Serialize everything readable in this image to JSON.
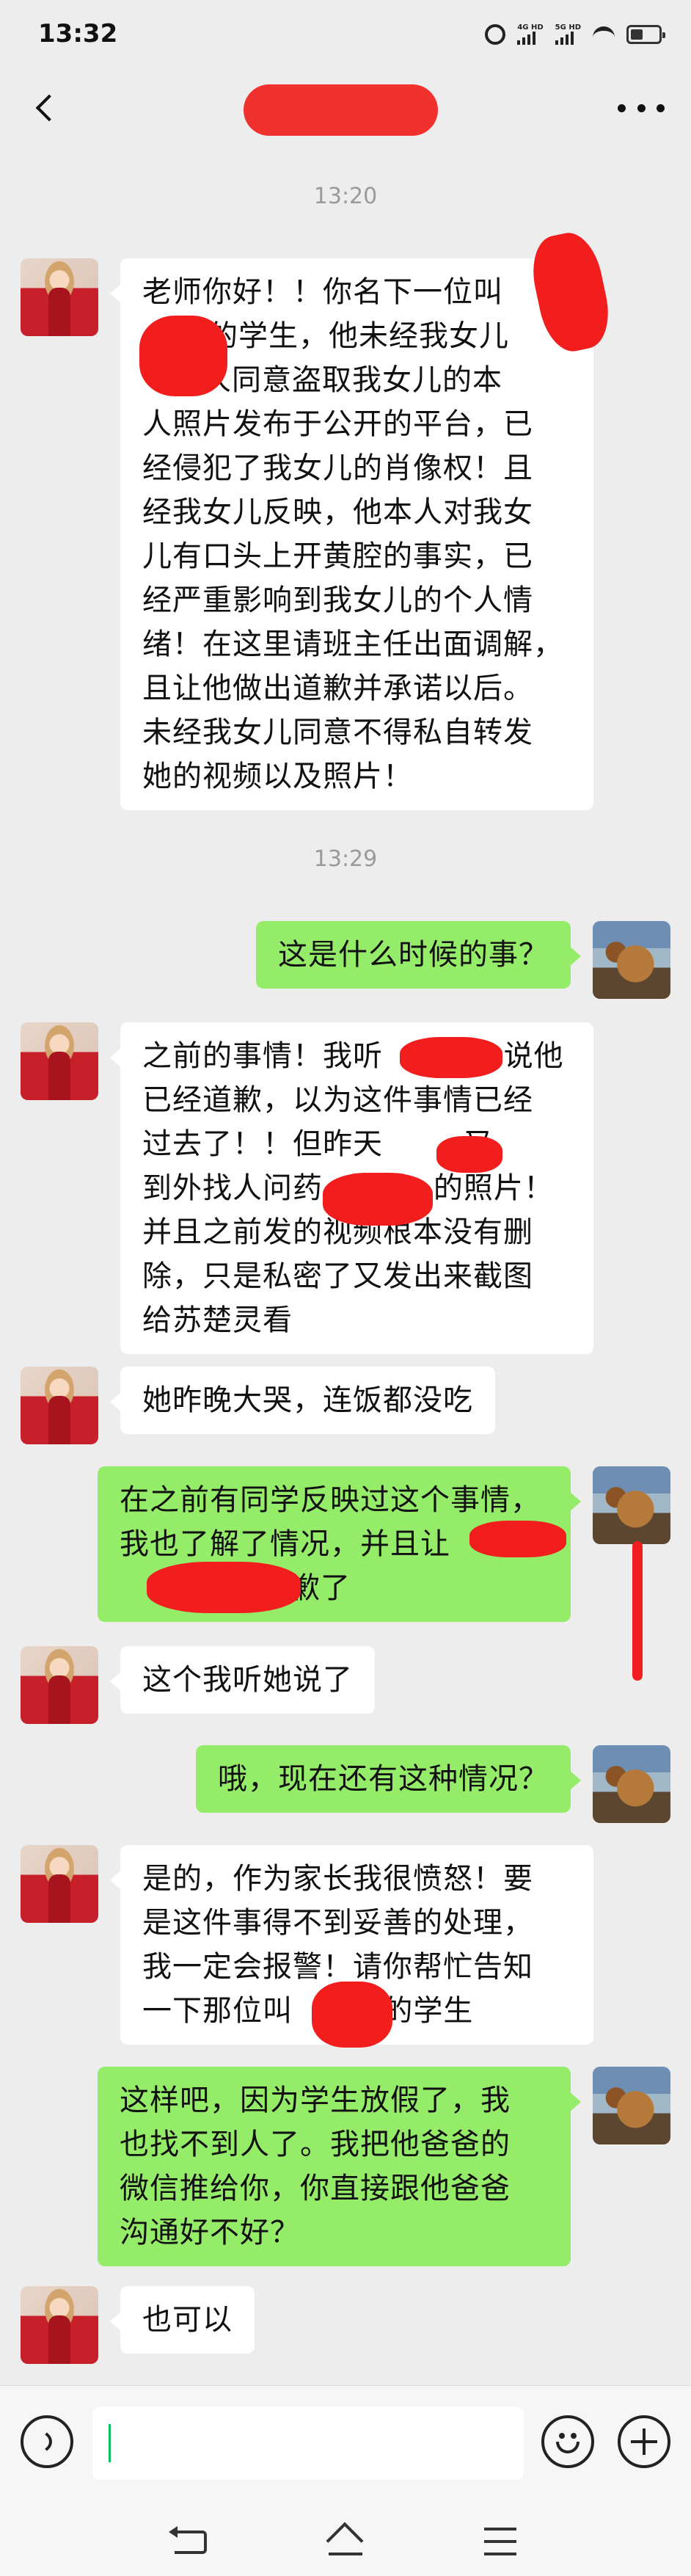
{
  "status_bar": {
    "time": "13:32",
    "signal_1": "4G HD",
    "signal_2": "5G HD"
  },
  "header": {
    "title_redacted": true,
    "redaction_color": "#f0312e"
  },
  "colors": {
    "self_bubble": "#95ec69",
    "other_bubble": "#ffffff",
    "background": "#ededed",
    "redaction": "#f21e1e"
  },
  "timestamps": [
    "13:20",
    "13:29"
  ],
  "messages": [
    {
      "from": "other",
      "lines": [
        "老师你好！！你名下一位叫",
        "的学生，他未经我女儿",
        "本人同意盗取我女儿的本",
        "人照片发布于公开的平台，已",
        "经侵犯了我女儿的肖像权！且",
        "经我女儿反映，他本人对我女",
        "儿有口头上开黄腔的事实，已",
        "经严重影响到我女儿的个人情",
        "绪！在这里请班主任出面调解，",
        "且让他做出道歉并承诺以后。",
        "未经我女儿同意不得私自转发",
        "她的视频以及照片！"
      ]
    },
    {
      "from": "self",
      "lines": [
        "这是什么时候的事？"
      ]
    },
    {
      "from": "other",
      "lines": [
        "之前的事情！我听",
        "已经道歉，以为这件事情已经",
        "过去了！！但昨天",
        "到外找人问药",
        "并且之前发的视频根本没有删",
        "除，只是私密了又发出来截图",
        "给苏楚灵看"
      ]
    },
    {
      "from": "other",
      "lines": [
        "她昨晚大哭，连饭都没吃"
      ]
    },
    {
      "from": "self",
      "lines": [
        "在之前有同学反映过这个事情，",
        "我也了解了情况，并且让",
        "道歉了"
      ]
    },
    {
      "from": "other",
      "lines": [
        "这个我听她说了"
      ]
    },
    {
      "from": "self",
      "lines": [
        "哦，现在还有这种情况？"
      ]
    },
    {
      "from": "other",
      "lines": [
        "是的，作为家长我很愤怒！要",
        "是这件事得不到妥善的处理，",
        "我一定会报警！请你帮忙告知",
        "一下那位叫",
        "的学生"
      ]
    },
    {
      "from": "self",
      "lines": [
        "这样吧，因为学生放假了，我",
        "也找不到人了。我把他爸爸的",
        "微信推给你，你直接跟他爸爸",
        "沟通好不好？"
      ]
    },
    {
      "from": "other",
      "lines": [
        "也可以"
      ]
    }
  ],
  "message_text": {
    "m1_l1": "老师你好！！你名下一位叫",
    "m1_l2": "的学生，他未经我女儿",
    "m1_l3": "本人同意盗取我女儿的本",
    "m1_rest": "人照片发布于公开的平台，已\n经侵犯了我女儿的肖像权！且\n经我女儿反映，他本人对我女\n儿有口头上开黄腔的事实，已\n经严重影响到我女儿的个人情\n绪！在这里请班主任出面调解，\n且让他做出道歉并承诺以后。\n未经我女儿同意不得私自转发\n她的视频以及照片！",
    "m2": "这是什么时候的事？",
    "m3": "之前的事情！我听            说他\n已经道歉，以为这件事情已经\n过去了！！但昨天        又\n到外找人问药           的照片！\n并且之前发的视频根本没有删\n除，只是私密了又发出来截图\n给苏楚灵看",
    "m4": "她昨晚大哭，连饭都没吃",
    "m5": "在之前有同学反映过这个事情，\n我也了解了情况，并且让\n              道歉了",
    "m6": "这个我听她说了",
    "m7": "哦，现在还有这种情况？",
    "m8": "是的，作为家长我很愤怒！要\n是这件事得不到妥善的处理，\n我一定会报警！请你帮忙告知\n一下那位叫         的学生",
    "m9": "这样吧，因为学生放假了，我\n也找不到人了。我把他爸爸的\n微信推给你，你直接跟他爸爸\n沟通好不好？",
    "m10": "也可以"
  },
  "input_bar": {
    "value": "",
    "icons": [
      "voice-icon",
      "emoji-icon",
      "plus-icon"
    ]
  },
  "nav_bar": {
    "icons": [
      "back-nav-icon",
      "home-nav-icon",
      "menu-nav-icon"
    ]
  }
}
